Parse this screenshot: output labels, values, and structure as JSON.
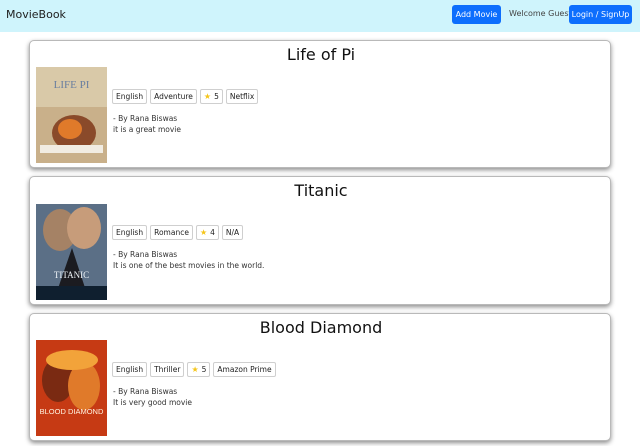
{
  "navbar": {
    "brand": "MovieBook",
    "add_movie_label": "Add Movie",
    "welcome_text": "Welcome Guest",
    "login_label": "Login / SignUp"
  },
  "movies": [
    {
      "title": "Life of Pi",
      "language": "English",
      "genre": "Adventure",
      "rating": "5",
      "platform": "Netflix",
      "author": "- By Rana Biswas",
      "review": "it is a great movie",
      "poster_text": "LIFE  PI"
    },
    {
      "title": "Titanic",
      "language": "English",
      "genre": "Romance",
      "rating": "4",
      "platform": "N/A",
      "author": "- By Rana Biswas",
      "review": "It is one of the best movies in the world.",
      "poster_text": "TITANIC"
    },
    {
      "title": "Blood Diamond",
      "language": "English",
      "genre": "Thriller",
      "rating": "5",
      "platform": "Amazon Prime",
      "author": "- By Rana Biswas",
      "review": "It is very good movie",
      "poster_text": "BLOOD DIAMOND"
    }
  ],
  "colors": {
    "navbar_bg": "#cff4fc",
    "primary_button": "#0d6efd",
    "star": "#f5c518"
  }
}
